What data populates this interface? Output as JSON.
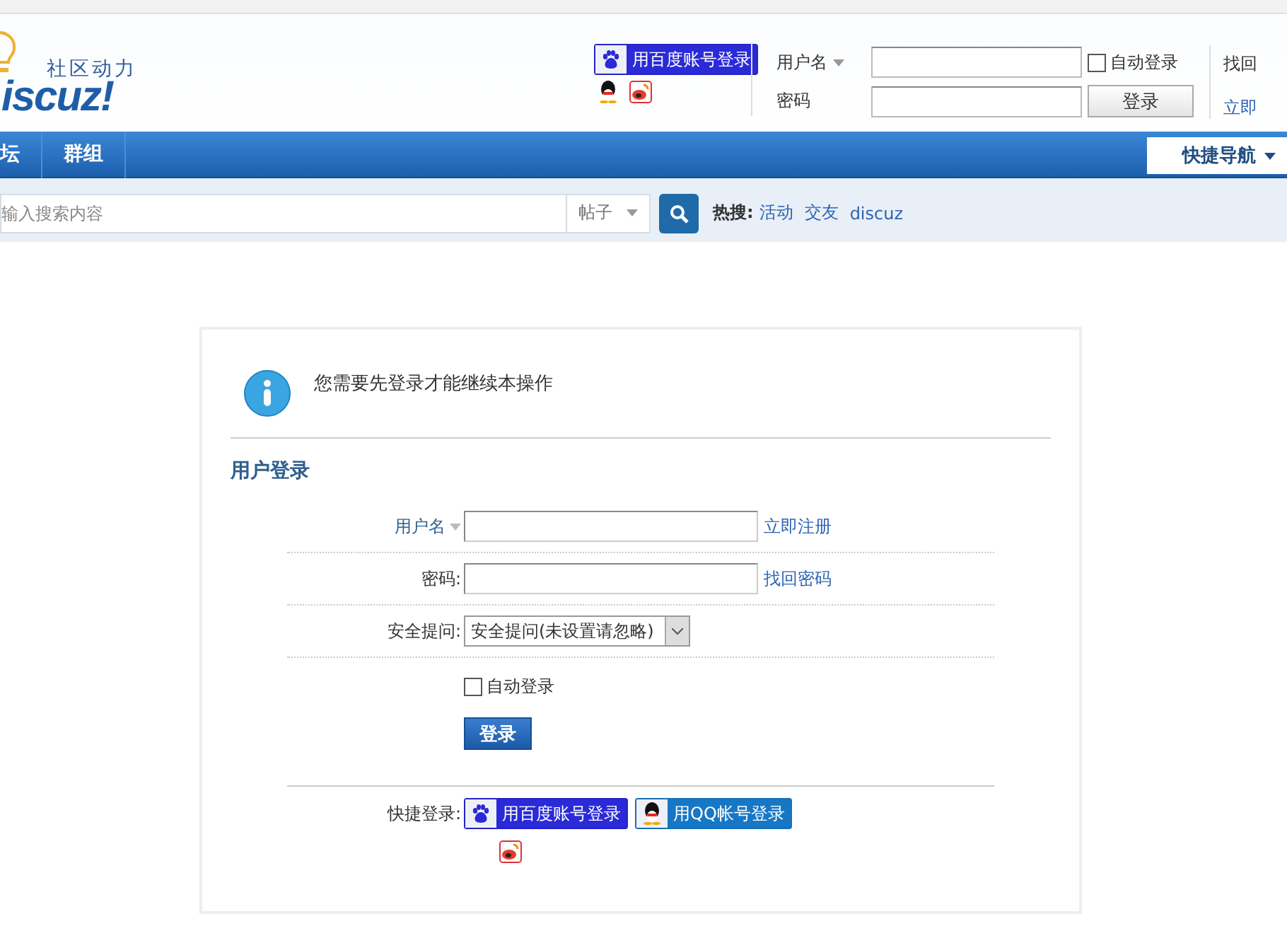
{
  "header": {
    "logo": {
      "tagline": "社区动力",
      "wordmark": "iscuz!"
    },
    "baidu_login": "用百度账号登录",
    "login": {
      "username_label": "用户名",
      "password_label": "密码",
      "auto_login": {
        "label": "自动登录",
        "checked": false
      },
      "submit": "登录",
      "links": [
        "找回",
        "立即"
      ]
    }
  },
  "nav": {
    "items": [
      {
        "label": "坛",
        "selected": false
      },
      {
        "label": "群组",
        "selected": false
      }
    ],
    "quick_nav": "快捷导航"
  },
  "search": {
    "placeholder": "输入搜索内容",
    "scope": "帖子",
    "hot_label": "热搜:",
    "hot_links": [
      "活动",
      "交友",
      "discuz"
    ]
  },
  "login_panel": {
    "message": "您需要先登录才能继续本操作",
    "title": "用户登录",
    "fields": [
      {
        "kind": "menu_input",
        "label": "用户名",
        "link": "立即注册"
      },
      {
        "kind": "input",
        "label": "密码:",
        "link": "找回密码"
      },
      {
        "kind": "select",
        "label": "安全提问:",
        "value": "安全提问(未设置请忽略)"
      }
    ],
    "auto_login": {
      "label": "自动登录",
      "checked": false
    },
    "submit": "登录",
    "quick_login": {
      "label": "快捷登录:",
      "buttons": [
        {
          "kind": "baidu",
          "label": "用百度账号登录"
        },
        {
          "kind": "qq",
          "label": "用QQ帐号登录"
        }
      ]
    }
  }
}
